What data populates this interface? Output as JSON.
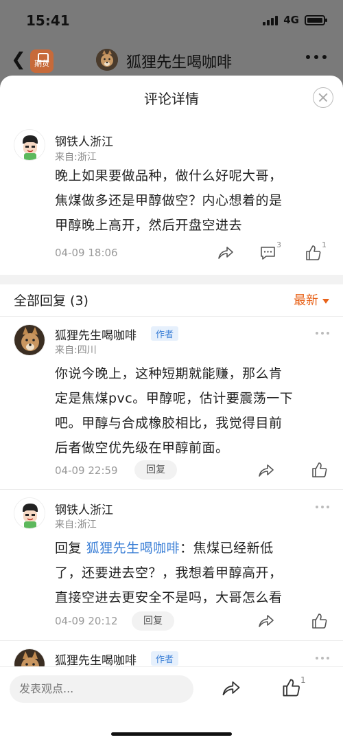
{
  "status_bar": {
    "time": "15:41",
    "network": "4G"
  },
  "app_header": {
    "app_badge": "期货",
    "title": "狐狸先生喝咖啡"
  },
  "sheet": {
    "title": "评论详情"
  },
  "main_comment": {
    "user": "钢铁人浙江",
    "location": "来自:浙江",
    "content_lines": [
      "晚上如果要做品种，做什么好呢大哥，",
      "焦煤做多还是甲醇做空？内心想着的是",
      "甲醇晚上高开，然后开盘空进去"
    ],
    "time": "04-09 18:06",
    "comment_count": "3",
    "like_count": "1"
  },
  "replies_header": {
    "label": "全部回复 (3)",
    "sort": "最新"
  },
  "replies": [
    {
      "user": "狐狸先生喝咖啡",
      "tag": "作者",
      "location": "来自:四川",
      "content_lines": [
        "你说今晚上，这种短期就能赚，那么肯",
        "定是焦煤pvc。甲醇呢，估计要震荡一下",
        "吧。甲醇与合成橡胶相比，我觉得目前",
        "后者做空优先级在甲醇前面。"
      ],
      "time": "04-09 22:59",
      "reply_label": "回复"
    },
    {
      "user": "钢铁人浙江",
      "location": "来自:浙江",
      "reply_prefix": "回复",
      "mention": "狐狸先生喝咖啡",
      "first_line_rest": "：焦煤已经新低",
      "content_lines": [
        "了，还要进去空？，我想着甲醇高开，",
        "直接空进去更安全不是吗，大哥怎么看"
      ],
      "time": "04-09 20:12",
      "reply_label": "回复"
    },
    {
      "user": "狐狸先生喝咖啡",
      "tag": "作者"
    }
  ],
  "bottom_bar": {
    "placeholder": "发表观点...",
    "like_count": "1"
  }
}
